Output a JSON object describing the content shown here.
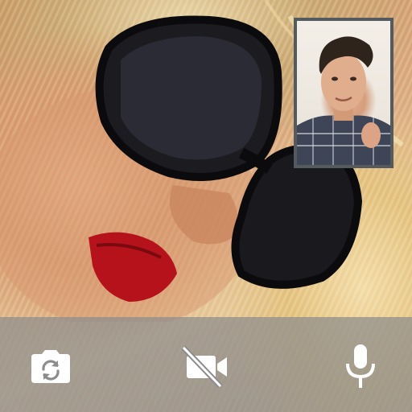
{
  "call": {
    "remote_feed": "remote-video-feed",
    "self_view": "local-camera-preview"
  },
  "controls": [
    {
      "id": "switch-camera",
      "icon": "camera-switch-icon"
    },
    {
      "id": "video-toggle",
      "icon": "video-off-icon"
    },
    {
      "id": "mute",
      "icon": "microphone-icon"
    }
  ],
  "colors": {
    "control_bar": "#8c8c8c",
    "icon": "#ffffff",
    "self_view_border": "#555a5e"
  }
}
